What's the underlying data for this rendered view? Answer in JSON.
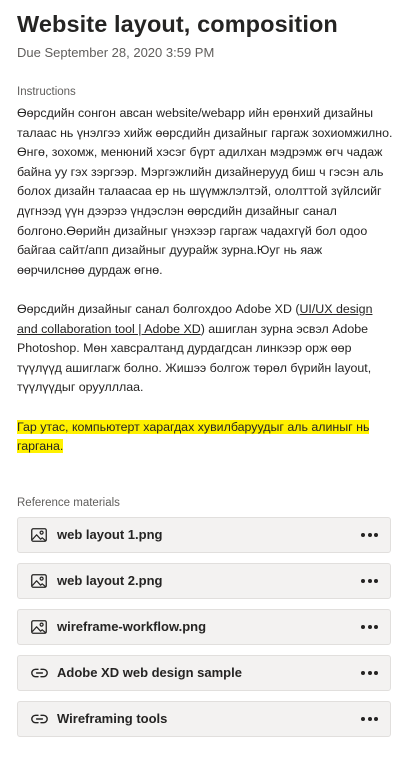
{
  "assignment": {
    "title": "Website layout, composition",
    "due": "Due September 28, 2020 3:59 PM"
  },
  "instructions": {
    "label": "Instructions",
    "paragraph1": "Өөрсдийн сонгон авсан website/webapp ийн ерөнхий дизайны талаас нь үнэлгээ хийж өөрсдийн дизайныг гаргаж зохиомжилно. Өнгө, зохомж, менюний хэсэг бүрт адилхан мэдрэмж өгч чадаж байна уу гэх зэргээр. Мэргэжлийн дизайнерууд биш ч гэсэн аль болох дизайн талаасаа ер нь шүүмжлэлтэй, ололттой зүйлсийг дүгнээд үүн дээрээ үндэслэн өөрсдийн дизайныг санал болгоно.Өөрийн дизайныг үнэхээр гаргаж чадахгүй бол одоо байгаа сайт/апп дизайныг дуурайж зурна.Юуг нь яаж өөрчилснөө дурдаж өгнө.",
    "paragraph2_before": "Өөрсдийн дизайныг санал болгохдоо Adobe XD (",
    "paragraph2_link": "UI/UX design and collaboration tool | Adobe XD",
    "paragraph2_after": ") ашиглан зурна эсвэл Adobe Photoshop. Мөн хавсралтанд дурдагдсан линкээр орж өөр түүлүүд ашиглагж болно. Жишээ болгож төрөл бүрийн layout, түүлүүдыг оруулллаа.",
    "highlight": "Гар утас, компьютерт харагдах хувилбаруудыг аль алиныг нь гаргана."
  },
  "references": {
    "label": "Reference materials",
    "items": [
      {
        "name": "web layout 1.png",
        "icon": "image-icon"
      },
      {
        "name": "web layout 2.png",
        "icon": "image-icon"
      },
      {
        "name": "wireframe-workflow.png",
        "icon": "image-icon"
      },
      {
        "name": "Adobe XD web design sample",
        "icon": "link-icon"
      },
      {
        "name": "Wireframing tools",
        "icon": "link-icon"
      }
    ]
  },
  "colors": {
    "highlight": "#fff100",
    "item_background": "#f3f2f1",
    "muted_text": "#605e5c"
  }
}
